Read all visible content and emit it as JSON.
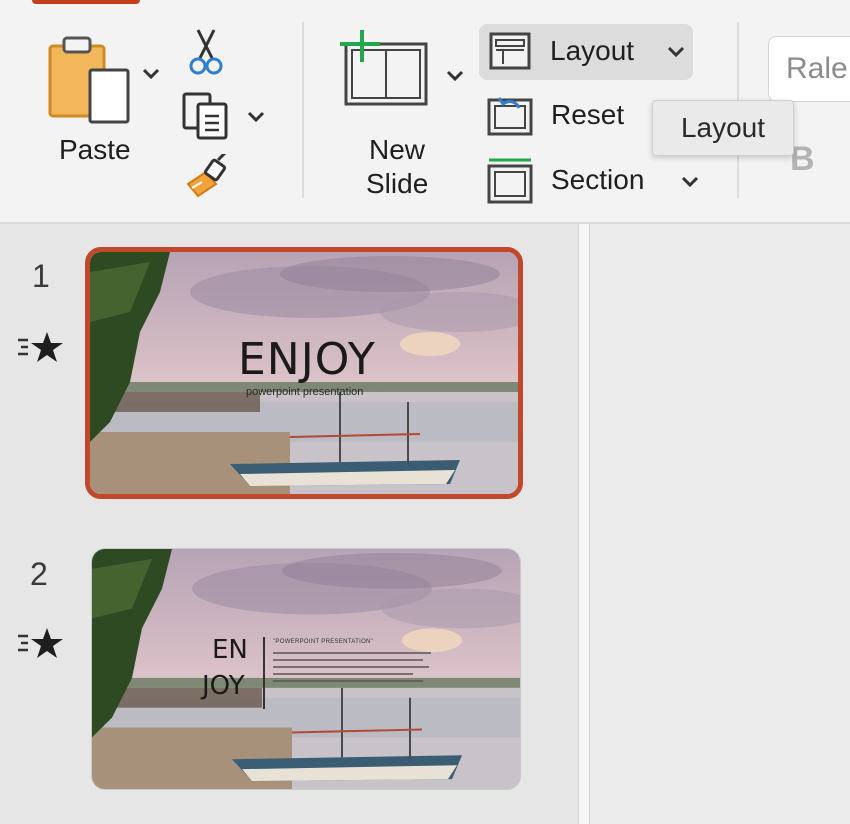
{
  "ribbon": {
    "paste_label": "Paste",
    "new_slide_label_line1": "New",
    "new_slide_label_line2": "Slide",
    "layout_label": "Layout",
    "reset_label": "Reset",
    "section_label": "Section",
    "font_name_value": "Rale",
    "bold_label": "B",
    "accent_color": "#c43e1c"
  },
  "tooltip": {
    "text": "Layout"
  },
  "slides": [
    {
      "number": "1",
      "selected": true,
      "title": "ENJOY",
      "subtitle": "powerpoint presentation",
      "has_animation": true
    },
    {
      "number": "2",
      "selected": false,
      "title_line1": "EN",
      "title_line2": "JOY",
      "heading": "\"POWERPOINT PRESENTATION\"",
      "has_animation": true
    }
  ],
  "icons": {
    "paste": "clipboard-icon",
    "cut": "scissors-icon",
    "copy": "copy-icon",
    "format_painter": "format-painter-icon",
    "new_slide": "new-slide-icon",
    "layout": "layout-icon",
    "reset": "reset-icon",
    "section": "section-icon",
    "animation": "animation-star-icon"
  }
}
